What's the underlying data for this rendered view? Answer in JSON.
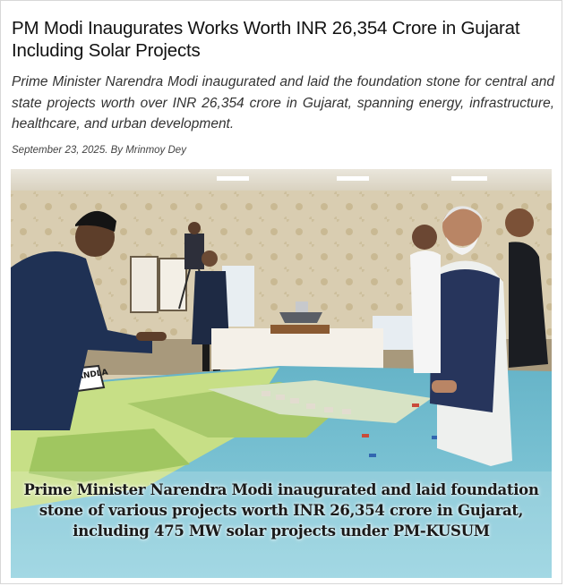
{
  "article": {
    "headline": "PM Modi Inaugurates Works Worth INR 26,354 Crore in Gujarat Including Solar Projects",
    "summary": "Prime Minister Narendra Modi inaugurated and laid the foundation stone for central and state projects worth over INR 26,354 crore in Gujarat, spanning energy, infrastructure, healthcare, and urban development.",
    "byline": "September 23, 2025. By Mrinmoy Dey"
  },
  "photo": {
    "caption": "Prime Minister Narendra Modi inaugurated and laid foundation stone of various projects worth INR 26,354 crore in Gujarat, including 475 MW solar projects under PM-KUSUM",
    "model_sign": "AYAL PORT - KANDLA"
  }
}
